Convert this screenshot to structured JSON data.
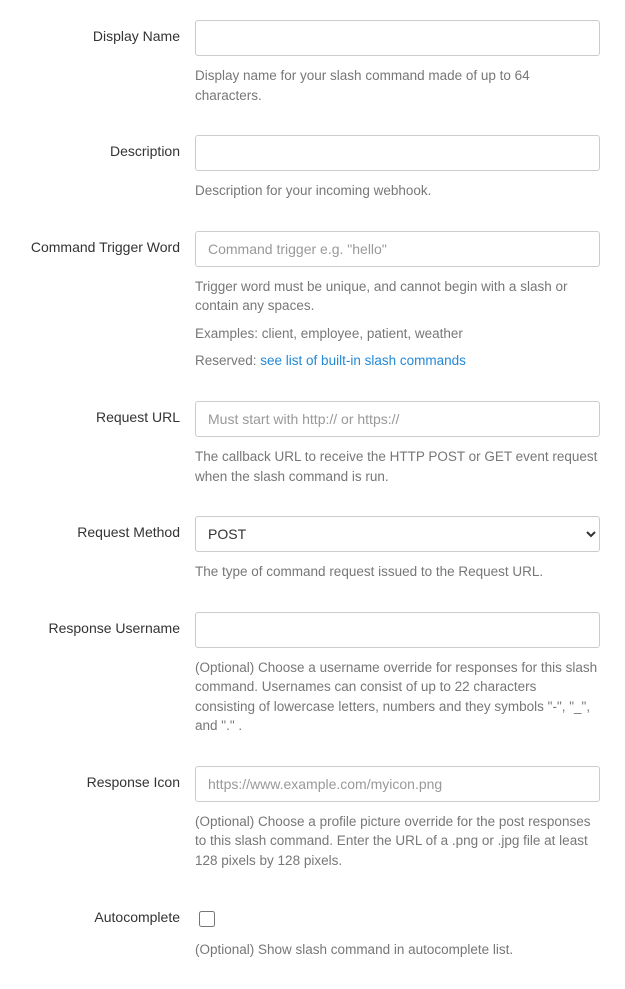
{
  "fields": {
    "displayName": {
      "label": "Display Name",
      "value": "",
      "placeholder": "",
      "help": "Display name for your slash command made of up to 64 characters."
    },
    "description": {
      "label": "Description",
      "value": "",
      "placeholder": "",
      "help": "Description for your incoming webhook."
    },
    "trigger": {
      "label": "Command Trigger Word",
      "value": "",
      "placeholder": "Command trigger e.g. \"hello\"",
      "help1": "Trigger word must be unique, and cannot begin with a slash or contain any spaces.",
      "help2": "Examples: client, employee, patient, weather",
      "reservedPrefix": "Reserved: ",
      "reservedLinkText": "see list of built-in slash commands"
    },
    "requestUrl": {
      "label": "Request URL",
      "value": "",
      "placeholder": "Must start with http:// or https://",
      "help": "The callback URL to receive the HTTP POST or GET event request when the slash command is run."
    },
    "requestMethod": {
      "label": "Request Method",
      "selected": "POST",
      "help": "The type of command request issued to the Request URL."
    },
    "responseUsername": {
      "label": "Response Username",
      "value": "",
      "placeholder": "",
      "help": "(Optional) Choose a username override for responses for this slash command. Usernames can consist of up to 22 characters consisting of lowercase letters, numbers and they symbols \"-\", \"_\", and \".\" ."
    },
    "responseIcon": {
      "label": "Response Icon",
      "value": "",
      "placeholder": "https://www.example.com/myicon.png",
      "help": "(Optional) Choose a profile picture override for the post responses to this slash command. Enter the URL of a .png or .jpg file at least 128 pixels by 128 pixels."
    },
    "autocomplete": {
      "label": "Autocomplete",
      "checked": false,
      "help": "(Optional) Show slash command in autocomplete list."
    }
  }
}
